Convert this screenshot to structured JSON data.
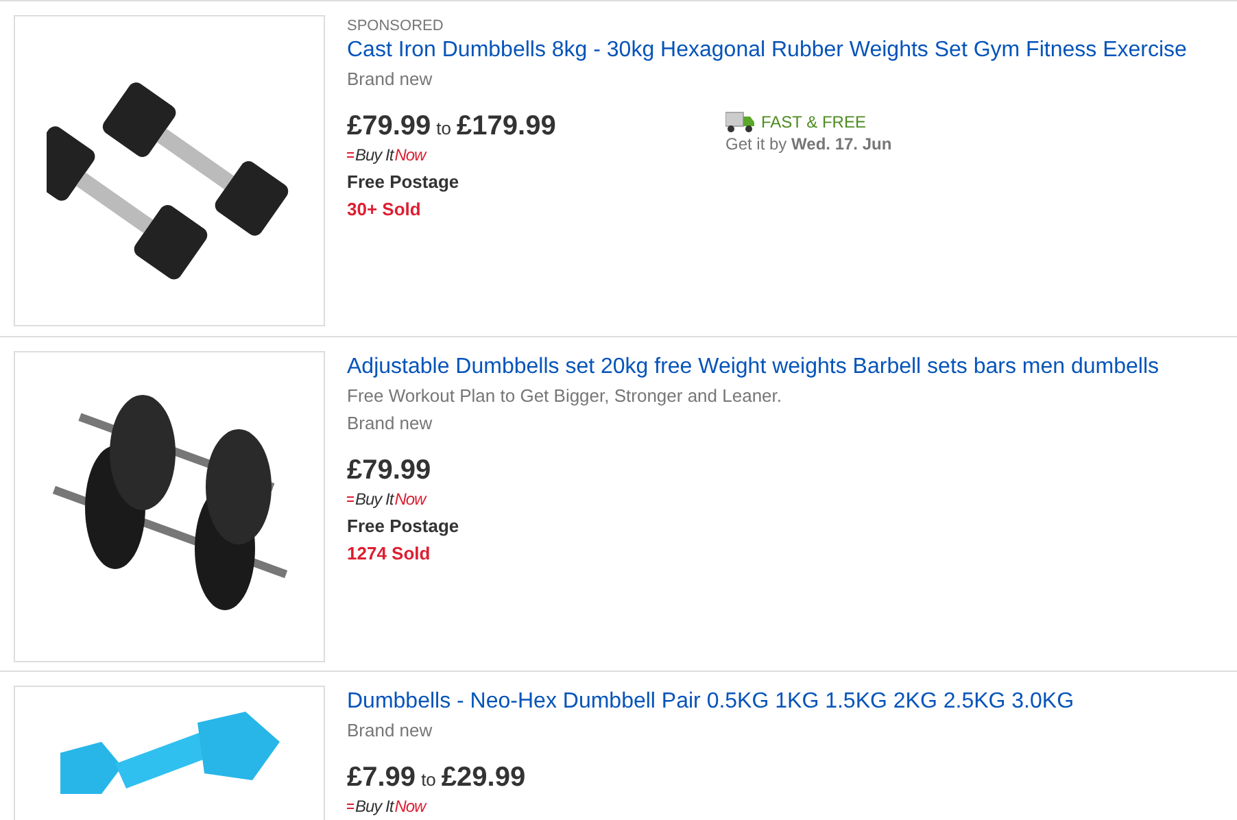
{
  "listings": [
    {
      "sponsored": "SPONSORED",
      "title": "Cast Iron Dumbbells 8kg - 30kg Hexagonal Rubber Weights Set Gym Fitness Exercise",
      "condition": "Brand new",
      "price_low": "£79.99",
      "price_sep": "to",
      "price_high": "£179.99",
      "buy_it_now": {
        "first": "Buy It",
        "second": "Now"
      },
      "postage": "Free Postage",
      "sold": "30+ Sold",
      "delivery": {
        "badge": "FAST & FREE",
        "eta": "Get it by **Wed. 17. Jun**"
      }
    },
    {
      "title": "Adjustable Dumbbells set 20kg free Weight weights Barbell sets bars men dumbells",
      "subtitle": "Free Workout Plan to Get Bigger, Stronger and Leaner.",
      "condition": "Brand new",
      "price_low": "£79.99",
      "buy_it_now": {
        "first": "Buy It",
        "second": "Now"
      },
      "postage": "Free Postage",
      "sold": "1274 Sold"
    },
    {
      "title": "Dumbbells - Neo-Hex Dumbbell Pair 0.5KG 1KG 1.5KG 2KG 2.5KG 3.0KG",
      "condition": "Brand new",
      "price_low": "£7.99",
      "price_sep": "to",
      "price_high": "£29.99",
      "buy_it_now": {
        "first": "Buy It",
        "second": "Now"
      }
    }
  ]
}
